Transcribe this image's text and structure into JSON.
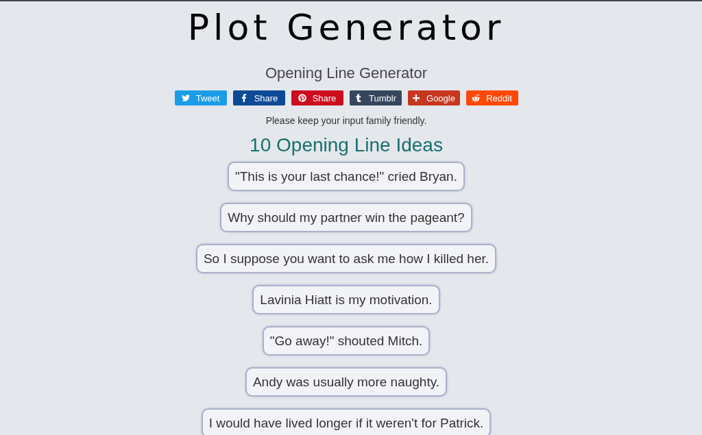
{
  "title": "Plot Generator",
  "subtitle": "Opening Line Generator",
  "share_buttons": [
    {
      "kind": "twitter",
      "label": "Tweet",
      "color": "#1b9ce6"
    },
    {
      "kind": "facebook",
      "label": "Share",
      "color": "#0e4b96"
    },
    {
      "kind": "pinterest",
      "label": "Share",
      "color": "#cc0d1d"
    },
    {
      "kind": "tumblr",
      "label": "Tumblr",
      "color": "#35465d"
    },
    {
      "kind": "google",
      "label": "Google",
      "color": "#c7361f"
    },
    {
      "kind": "reddit",
      "label": "Reddit",
      "color": "#ff4806"
    }
  ],
  "notice": "Please keep your input family friendly.",
  "results": {
    "heading": "10 Opening Line Ideas",
    "ideas": [
      "\"This is your last chance!\" cried Bryan.",
      "Why should my partner win the pageant?",
      "So I suppose you want to ask me how I killed her.",
      "Lavinia Hiatt is my motivation.",
      "\"Go away!\" shouted Mitch.",
      "Andy was usually more naughty.",
      "I would have lived longer if it weren't for Patrick."
    ]
  }
}
